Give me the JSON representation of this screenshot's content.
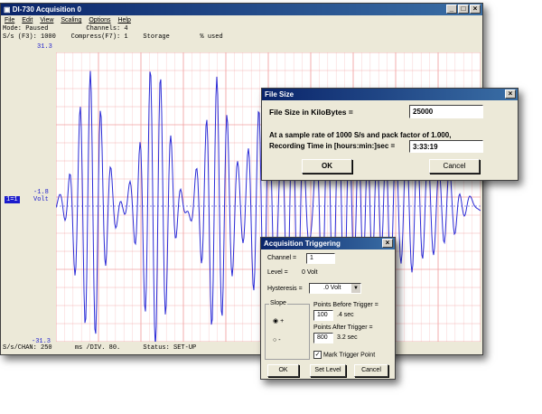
{
  "main_window": {
    "title": "DI-730 Acquisition 0",
    "menu": [
      "File",
      "Edit",
      "View",
      "Scaling",
      "Options",
      "Help"
    ],
    "status_line1": "Mode: Paused          Channels: 4",
    "status_line2": "S/s (F3): 1000    Compress(F7): 1    Storage        % used",
    "y_top": "31.3",
    "y_mid": "-1.8",
    "y_bottom": "-31.3",
    "channel_tag": "1=1",
    "channel_unit": "Volt",
    "bottom_status": "S/s/CHAN: 250      ms /DIV. 80.      Status: SET-UP"
  },
  "file_size_dialog": {
    "title": "File Size",
    "size_label": "File Size in KiloBytes =",
    "size_value": "25000",
    "rate_text": "At a sample rate of 1000 S/s and pack factor of 1.000,",
    "time_label": "Recording Time in [hours:min:]sec =",
    "time_value": "3:33:19",
    "ok": "OK",
    "cancel": "Cancel"
  },
  "trigger_dialog": {
    "title": "Acquisition Triggering",
    "channel_label": "Channel =",
    "channel_value": "1",
    "level_label": "Level =",
    "level_value": "0 Volt",
    "hysteresis_label": "Hysteresis =",
    "hysteresis_value": ".0 Volt",
    "slope_label": "Slope",
    "slope_plus": "+",
    "slope_minus": "-",
    "before_label": "Points Before Trigger =",
    "before_value": "100",
    "before_time": ".4 sec",
    "after_label": "Points After Trigger =",
    "after_value": "800",
    "after_time": "3.2 sec",
    "mark_label": "Mark Trigger Point",
    "ok": "OK",
    "set_level": "Set Level",
    "cancel": "Cancel"
  },
  "colors": {
    "trace": "#2b2bd6",
    "grid": "#f2a0a0",
    "title_bar": "#0a246a"
  }
}
